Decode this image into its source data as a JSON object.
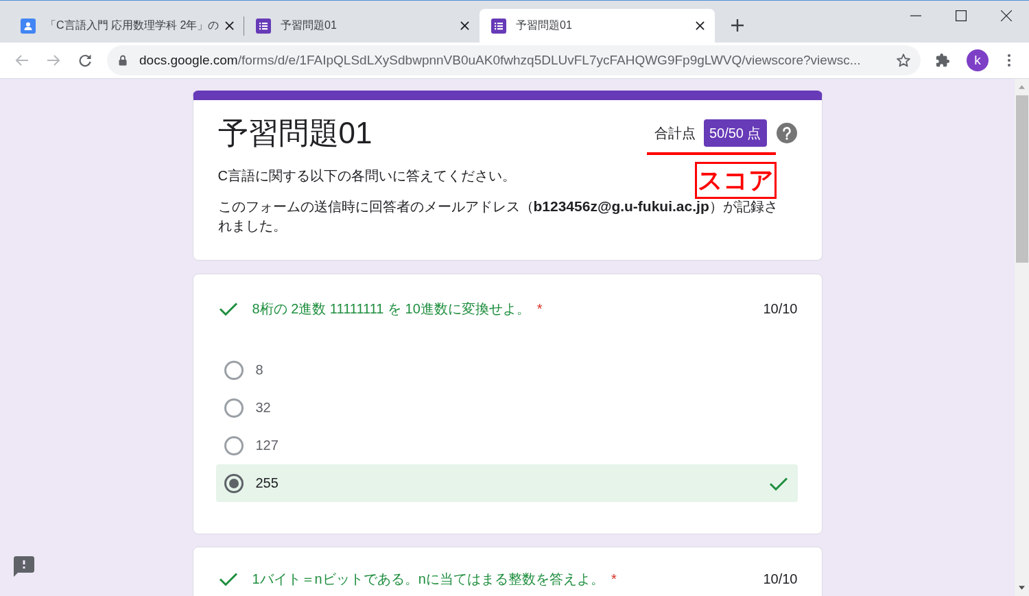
{
  "browser": {
    "tabs": [
      {
        "title": "「C言語入門 応用数理学科 2年」の",
        "kind": "person",
        "selected": false
      },
      {
        "title": "予習問題01",
        "kind": "list",
        "selected": false
      },
      {
        "title": "予習問題01",
        "kind": "list",
        "selected": true
      }
    ],
    "back": {
      "disabled": true
    },
    "forward": {
      "disabled": true
    },
    "address": {
      "host": "docs.google.com",
      "path": "/forms/d/e/1FAIpQLSdLXySdbwpnnVB0uAK0fwhzq5DLUvFL7ycFAHQWG9Fp9gLWVQ/viewscore?viewsc..."
    },
    "profile_initial": "k"
  },
  "form": {
    "title": "予習問題01",
    "score_label": "合計点",
    "score": "50/50 点",
    "description": "C言語に関する以下の各問いに答えてください。",
    "email_notice": "このフォームの送信時に回答者のメールアドレス（**b123456z@g.u-fukui.ac.jp**）が記録されました。",
    "questions": [
      {
        "text": "8桁の 2進数 11111111 を 10進数に変換せよ。",
        "required_mark": "*",
        "correct": true,
        "points": "10/10",
        "options": [
          {
            "label": "8",
            "selected": false
          },
          {
            "label": "32",
            "selected": false
          },
          {
            "label": "127",
            "selected": false
          },
          {
            "label": "255",
            "selected": true
          }
        ]
      },
      {
        "text": "1バイト＝nビットである。nに当てはまる整数を答えよ。",
        "required_mark": "*",
        "correct": true,
        "points": "10/10"
      }
    ]
  },
  "annotation": {
    "label": "スコア"
  }
}
